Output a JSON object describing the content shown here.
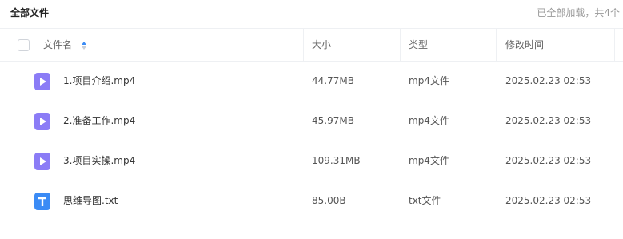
{
  "header": {
    "breadcrumb": "全部文件",
    "loaded_status": "已全部加载，共4个"
  },
  "table": {
    "columns": {
      "name": "文件名",
      "size": "大小",
      "type": "类型",
      "modified": "修改时间"
    },
    "rows": [
      {
        "name": "1.项目介绍.mp4",
        "size": "44.77MB",
        "type": "mp4文件",
        "modified": "2025.02.23 02:53",
        "icon": "video-file-icon"
      },
      {
        "name": "2.准备工作.mp4",
        "size": "45.97MB",
        "type": "mp4文件",
        "modified": "2025.02.23 02:53",
        "icon": "video-file-icon"
      },
      {
        "name": "3.项目实操.mp4",
        "size": "109.31MB",
        "type": "mp4文件",
        "modified": "2025.02.23 02:53",
        "icon": "video-file-icon"
      },
      {
        "name": "思维导图.txt",
        "size": "85.00B",
        "type": "txt文件",
        "modified": "2025.02.23 02:53",
        "icon": "text-file-icon"
      }
    ]
  },
  "colors": {
    "video_icon": "#8b7cf6",
    "text_icon": "#3b8bf5",
    "sort_active": "#3b8bf5"
  }
}
